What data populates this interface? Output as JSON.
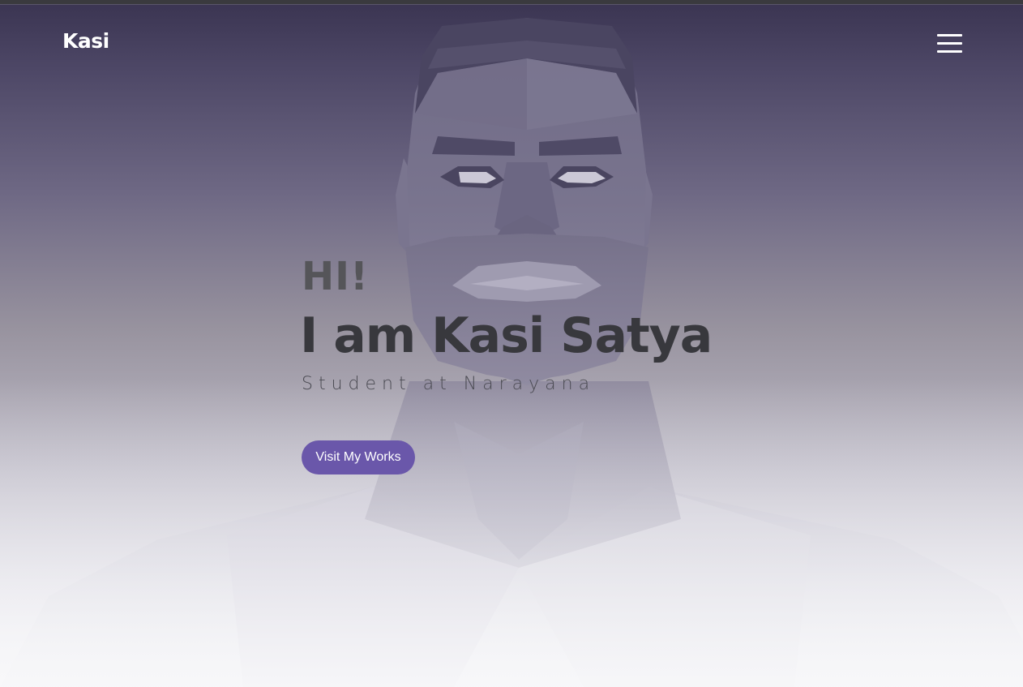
{
  "header": {
    "logo_text": "Kasi",
    "menu_icon": "hamburger-menu-icon"
  },
  "hero": {
    "greeting": "HI!",
    "headline": "I am Kasi Satya",
    "subtitle": "Student at Narayana",
    "cta_label": "Visit My Works",
    "background_image": "low-poly-portrait-illustration"
  },
  "colors": {
    "accent": "#6a57aa",
    "header_bg_top": "#3a3451",
    "page_bg_bottom": "#f7f7f8",
    "headline_text": "#38383d",
    "greeting_text": "#555559"
  }
}
